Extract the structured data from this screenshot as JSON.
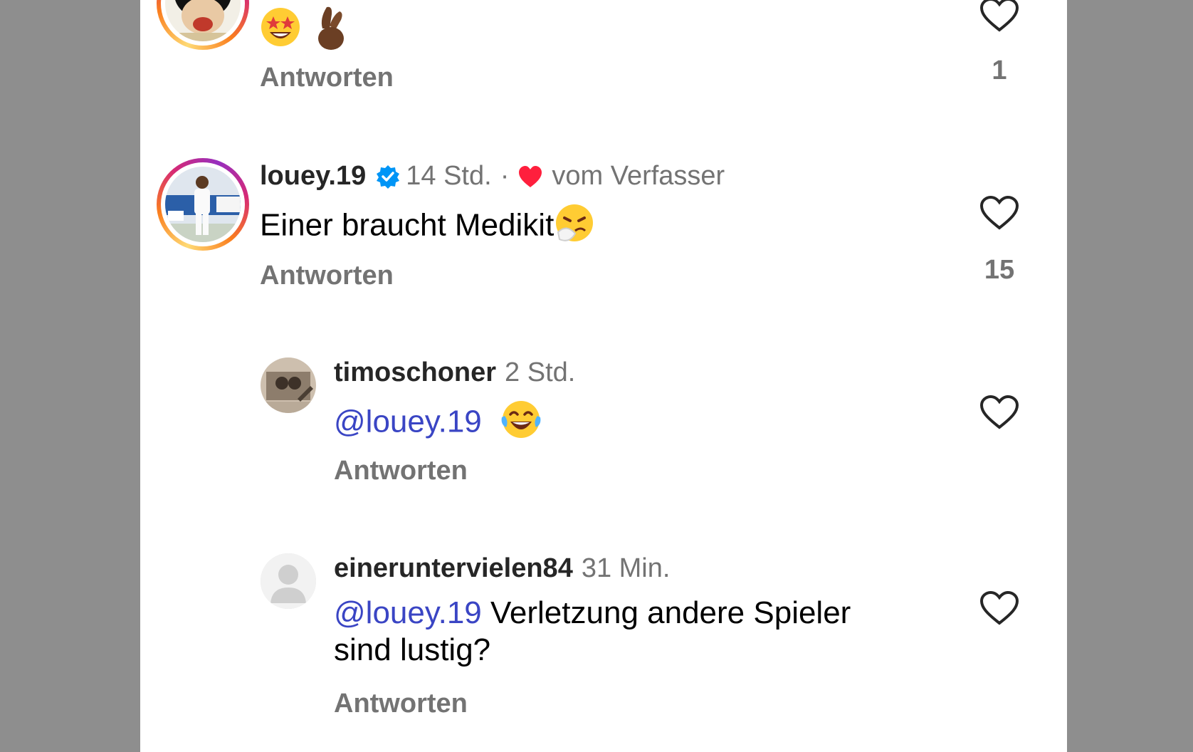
{
  "comments": [
    {
      "text_suffix": "",
      "reply_label": "Antworten",
      "likes": "1",
      "emojis": [
        "star-struck-emoji",
        "crossed-fingers-emoji"
      ]
    },
    {
      "username": "louey.19",
      "time": "14 Std.",
      "separator": "·",
      "author_like_label": "vom Verfasser",
      "text": "Einer braucht Medikit",
      "reply_label": "Antworten",
      "likes": "15",
      "emojis": [
        "sneezing-face-emoji"
      ]
    },
    {
      "username": "timoschoner",
      "time": "2 Std.",
      "mention": "@louey.19",
      "text": "",
      "reply_label": "Antworten",
      "emojis": [
        "tears-of-joy-emoji"
      ]
    },
    {
      "username": "eineruntervielen84",
      "time": "31 Min.",
      "mention": "@louey.19",
      "text": " Verletzung andere Spieler sind lustig?",
      "reply_label": "Antworten"
    }
  ],
  "colors": {
    "mention": "#3a45c4",
    "author_heart": "#ff1f3d",
    "verified": "#0095f6",
    "muted": "#737373"
  }
}
